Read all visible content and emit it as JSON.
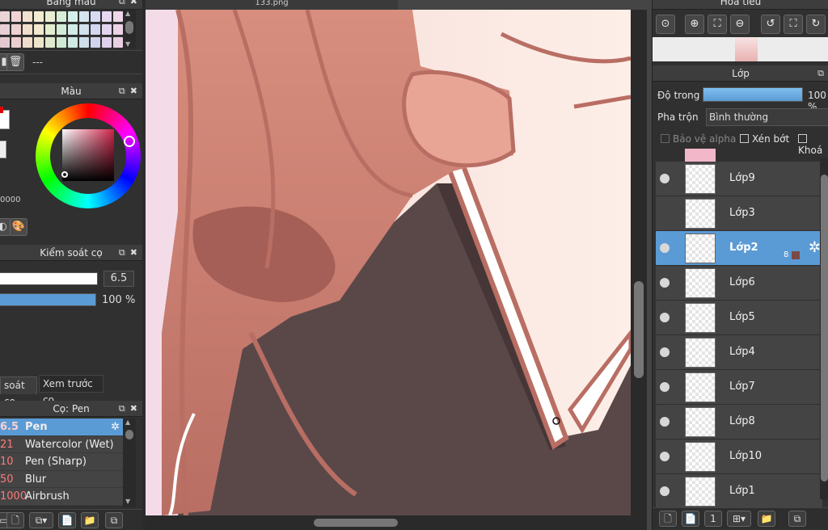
{
  "left_panel": {
    "swatch_header": "Bảng màu",
    "swatch_status": "---",
    "swatch_colors": [
      "#e9d4d8",
      "#f1d3d3",
      "#f3e1d0",
      "#f2ecd0",
      "#e9f0d2",
      "#d6efd6",
      "#d4efe9",
      "#d6e6f1",
      "#d8d9f2",
      "#e6d8f1",
      "#f0d7ea",
      "#e7cfd3",
      "#eed2d2",
      "#f1dfcc",
      "#f0e9cd",
      "#e3edcf",
      "#d3ecd6",
      "#d3ece6",
      "#d2e1ee",
      "#d5d6ef",
      "#e2d4ee",
      "#edd3e6",
      "#e4cad0",
      "#ebcfcf",
      "#efdcca",
      "#eee6ca",
      "#e0eacc",
      "#d0e9d3",
      "#d0e9e3",
      "#cfdeeb",
      "#d2d3ec",
      "#dfd1eb",
      "#eacfe3"
    ],
    "color_header": "Màu",
    "color_hex": "0000",
    "brush_control_header": "Kiểm soát cọ",
    "brush_size_value": "6.5",
    "brush_opacity_value": "100 %",
    "brush_opacity_percent": 100,
    "tabs": {
      "active": "soát cọ",
      "inactive": "Xem trước cọ"
    },
    "brush_header": "Cọ: Pen",
    "brushes": [
      {
        "size": "6.5",
        "name": "Pen",
        "selected": true
      },
      {
        "size": "21",
        "name": "Watercolor (Wet)",
        "selected": false
      },
      {
        "size": "10",
        "name": "Pen (Sharp)",
        "selected": false
      },
      {
        "size": "50",
        "name": "Blur",
        "selected": false
      },
      {
        "size": "1000",
        "name": "Airbrush",
        "selected": false
      }
    ]
  },
  "canvas": {
    "doc_tab": "133.png"
  },
  "right_panel": {
    "navigator_header": "Hoa tiêu",
    "layer_header": "Lớp",
    "opacity_label": "Độ trong",
    "opacity_value": "100 %",
    "opacity_percent": 100,
    "blend_label": "Pha trộn",
    "blend_value": "Bình thường",
    "protect_alpha_label": "Bảo vệ alpha",
    "clipping_label": "Xén bớt",
    "lock_label": "Khoá",
    "selected_layer_badge": "8",
    "layers": [
      {
        "name": "Lớp9",
        "visible": true,
        "selected": false
      },
      {
        "name": "Lớp3",
        "visible": false,
        "selected": false
      },
      {
        "name": "Lớp2",
        "visible": true,
        "selected": true
      },
      {
        "name": "Lớp6",
        "visible": true,
        "selected": false
      },
      {
        "name": "Lớp5",
        "visible": true,
        "selected": false
      },
      {
        "name": "Lớp4",
        "visible": true,
        "selected": false
      },
      {
        "name": "Lớp7",
        "visible": true,
        "selected": false
      },
      {
        "name": "Lớp8",
        "visible": true,
        "selected": false
      },
      {
        "name": "Lớp10",
        "visible": true,
        "selected": false
      },
      {
        "name": "Lớp1",
        "visible": true,
        "selected": false
      }
    ]
  },
  "icons": {
    "panel_float": "float-window-icon",
    "panel_close": "close-icon",
    "trash": "trash-icon",
    "gear": "gear-icon"
  },
  "colors": {
    "accent": "#5b9bd5",
    "panel_bg": "#303030",
    "brush_size_text": "#ff7a7a"
  }
}
